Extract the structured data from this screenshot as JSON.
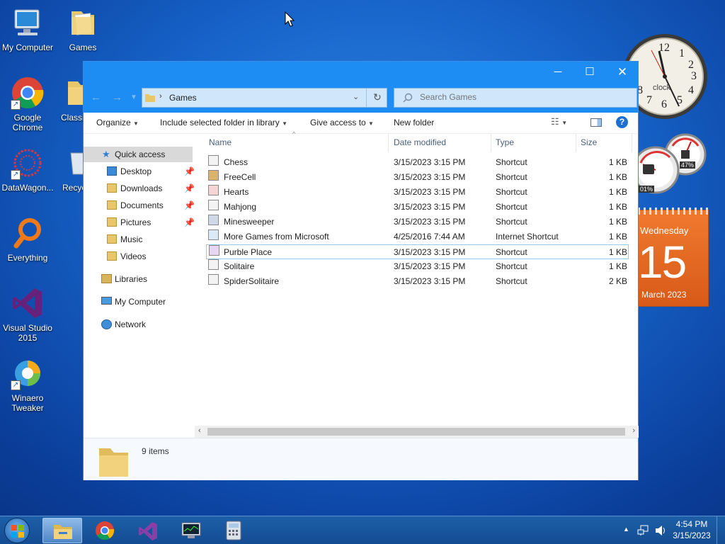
{
  "desktop": {
    "icons": [
      {
        "label": "My Computer"
      },
      {
        "label": "Games"
      },
      {
        "label": "Google Chrome"
      },
      {
        "label": "Classi"
      },
      {
        "label": "DataWagon..."
      },
      {
        "label": "Recyc"
      },
      {
        "label": "Everything"
      },
      {
        "label": "Visual Studio 2015"
      },
      {
        "label": "Winaero Tweaker"
      }
    ]
  },
  "explorer": {
    "address": {
      "folder": "Games"
    },
    "search": {
      "placeholder": "Search Games"
    },
    "toolbar": {
      "organize": "Organize",
      "include": "Include selected folder in library",
      "give_access": "Give access to",
      "new_folder": "New folder"
    },
    "nav": {
      "quick_access": "Quick access",
      "desktop": "Desktop",
      "downloads": "Downloads",
      "documents": "Documents",
      "pictures": "Pictures",
      "music": "Music",
      "videos": "Videos",
      "libraries": "Libraries",
      "my_computer": "My Computer",
      "network": "Network"
    },
    "columns": {
      "name": "Name",
      "date": "Date modified",
      "type": "Type",
      "size": "Size"
    },
    "files": [
      {
        "name": "Chess",
        "date": "3/15/2023 3:15 PM",
        "type": "Shortcut",
        "size": "1 KB"
      },
      {
        "name": "FreeCell",
        "date": "3/15/2023 3:15 PM",
        "type": "Shortcut",
        "size": "1 KB"
      },
      {
        "name": "Hearts",
        "date": "3/15/2023 3:15 PM",
        "type": "Shortcut",
        "size": "1 KB"
      },
      {
        "name": "Mahjong",
        "date": "3/15/2023 3:15 PM",
        "type": "Shortcut",
        "size": "1 KB"
      },
      {
        "name": "Minesweeper",
        "date": "3/15/2023 3:15 PM",
        "type": "Shortcut",
        "size": "1 KB"
      },
      {
        "name": "More Games from Microsoft",
        "date": "4/25/2016 7:44 AM",
        "type": "Internet Shortcut",
        "size": "1 KB"
      },
      {
        "name": "Purble Place",
        "date": "3/15/2023 3:15 PM",
        "type": "Shortcut",
        "size": "1 KB"
      },
      {
        "name": "Solitaire",
        "date": "3/15/2023 3:15 PM",
        "type": "Shortcut",
        "size": "1 KB"
      },
      {
        "name": "SpiderSolitaire",
        "date": "3/15/2023 3:15 PM",
        "type": "Shortcut",
        "size": "2 KB"
      }
    ],
    "status": {
      "count": "9 items"
    }
  },
  "gadgets": {
    "clock": {
      "label": "clock",
      "n12": "12",
      "n1": "1",
      "n2": "2",
      "n3": "3",
      "n4": "4",
      "n5": "5",
      "n6": "6",
      "n7": "7",
      "n8": "8"
    },
    "meter": {
      "cpu": "01%",
      "memory": "47%"
    },
    "calendar": {
      "weekday": "Wednesday",
      "day": "15",
      "month_year": "March 2023"
    }
  },
  "taskbar": {
    "time": "4:54 PM",
    "date": "3/15/2023"
  }
}
